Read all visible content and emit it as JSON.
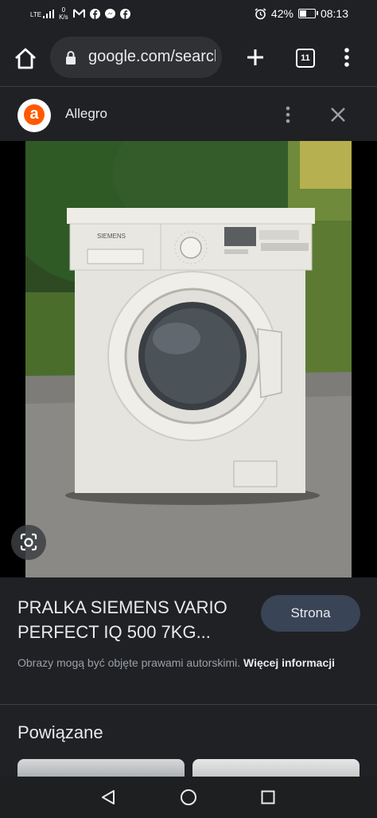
{
  "status_bar": {
    "network": "LTE",
    "speed_value": "0",
    "speed_unit": "K/s",
    "battery": "42%",
    "battery_level": 0.42,
    "time": "08:13",
    "notification_icons": [
      "gmail-icon",
      "facebook-icon",
      "messenger-icon",
      "facebook-icon"
    ]
  },
  "browser": {
    "url": "google.com/search",
    "tab_count": "11"
  },
  "source": {
    "logo_letter": "a",
    "name": "Allegro"
  },
  "result": {
    "title": "PRALKA SIEMENS VARIO PERFECT IQ 500 7KG...",
    "visit_label": "Strona",
    "copyright_text": "Obrazy mogą być objęte prawami autorskimi.",
    "more_info_label": "Więcej informacji"
  },
  "related": {
    "heading": "Powiązane"
  },
  "photo": {
    "brand_label": "SIEMENS"
  },
  "colors": {
    "background": "#202124",
    "button": "#394457",
    "allegro_orange": "#ff5a00"
  }
}
